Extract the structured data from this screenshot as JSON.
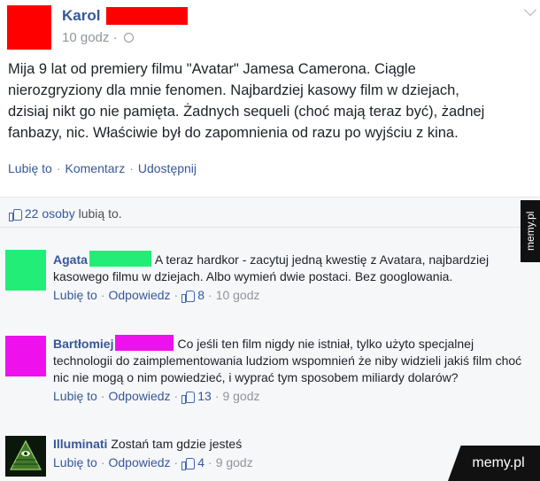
{
  "post": {
    "author": "Karol",
    "time": "10 godz",
    "time_sep": "·",
    "text": "Mija 9 lat od premiery filmu \"Avatar\" Jamesa Camerona. Ciągle\nnierozgryziony dla mnie fenomen. Najbardziej kasowy film w dziejach,\ndzisiaj nikt go nie pamięta. Żadnych sequeli (choć mają teraz być), żadnej\nfanbazy, nic. Właściwie był do zapomnienia od razu po wyjściu z kina.",
    "actions": {
      "like": "Lubię to",
      "comment": "Komentarz",
      "share": "Udostępnij",
      "sep": "·"
    },
    "avatar_color": "#ff0000",
    "redaction_color": "#ff0000"
  },
  "likes": {
    "count": "22 osoby",
    "suffix": "lubią to."
  },
  "comments": [
    {
      "author": "Agata",
      "text": "A teraz hardkor - zacytuj jedną kwestię z Avatara, najbardziej kasowego filmu w dziejach. Albo wymień dwie postaci. Bez googlowania.",
      "like": "Lubię to",
      "reply": "Odpowiedz",
      "likes": "8",
      "time": "10 godz",
      "color": "#22ee77"
    },
    {
      "author": "Bartłomiej",
      "text": "Co jeśli ten film nigdy nie istniał, tylko użyto specjalnej technologii do zaimplementowania ludziom wspomnień że niby widzieli jakiś film choć nic nie mogą o nim powiedzieć, i wyprać tym sposobem miliardy dolarów?",
      "like": "Lubię to",
      "reply": "Odpowiedz",
      "likes": "13",
      "time": "9 godz",
      "color": "#ee11ee"
    },
    {
      "author": "Illuminati",
      "text": "Zostań tam gdzie jesteś",
      "like": "Lubię to",
      "reply": "Odpowiedz",
      "likes": "4",
      "time": "9 godz"
    }
  ],
  "action_sep": "·",
  "watermark": {
    "side": "memy.pl",
    "bottom": "memy.pl"
  }
}
